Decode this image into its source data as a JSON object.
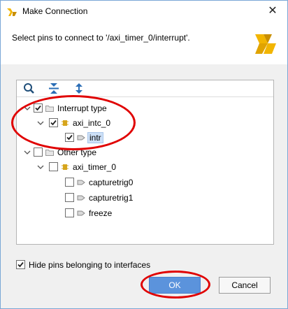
{
  "window": {
    "title": "Make Connection",
    "close_glyph": "✕"
  },
  "header": {
    "prompt": "Select pins to connect to '/axi_timer_0/interrupt'."
  },
  "toolbar": {
    "icons": [
      "search-icon",
      "collapse-all-icon",
      "expand-all-icon"
    ]
  },
  "tree": {
    "interrupt_type": {
      "label": "Interrupt type",
      "checked": true
    },
    "axi_intc_0": {
      "label": "axi_intc_0",
      "checked": true
    },
    "intr": {
      "label": "intr",
      "checked": true
    },
    "other_type": {
      "label": "Other type",
      "checked": false
    },
    "axi_timer_0": {
      "label": "axi_timer_0",
      "checked": false
    },
    "capturetrig0": {
      "label": "capturetrig0",
      "checked": false
    },
    "capturetrig1": {
      "label": "capturetrig1",
      "checked": false
    },
    "freeze": {
      "label": "freeze",
      "checked": false
    }
  },
  "options": {
    "hide_pins_label": "Hide pins belonging to interfaces",
    "hide_pins_checked": true
  },
  "buttons": {
    "ok": "OK",
    "cancel": "Cancel"
  },
  "colors": {
    "accent": "#5b93dc",
    "annotation": "#e00000",
    "brand_yellow": "#f2b500"
  }
}
